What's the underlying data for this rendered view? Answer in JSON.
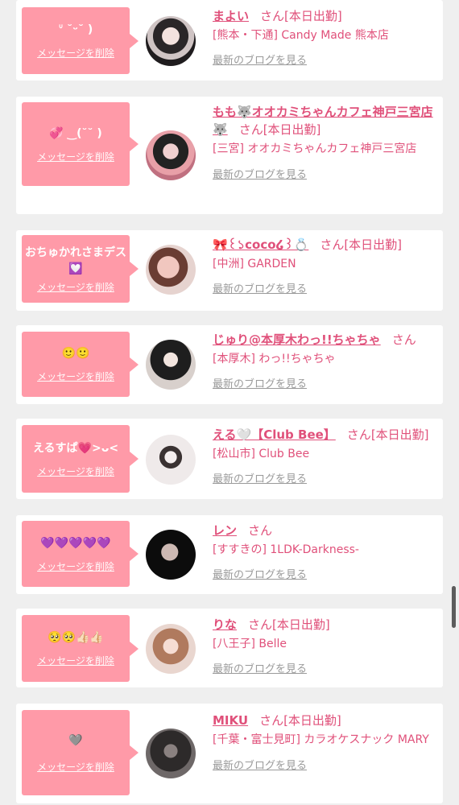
{
  "delete_label": "メッセージを削除",
  "san_suffix": "さん",
  "blog_link": "最新のブログを見る",
  "colors": {
    "accent": "#e0507a",
    "bubble": "#ff9aa8"
  },
  "entries": [
    {
      "message": "ᐡ ˘ᵕ˘ )",
      "name": "まよい",
      "status": "[本日出勤]",
      "shop": "[熊本・下通] Candy Made 熊本店"
    },
    {
      "message": "💞 ‿(˘˘ )",
      "name": "もも🐺オオカミちゃんカフェ神戸三宮店🐺",
      "status": "[本日出勤]",
      "shop": "[三宮] オオカミちゃんカフェ神戸三宮店"
    },
    {
      "message": "おちゅかれさまデス💟",
      "name": "🎀꒰১coco໒꒱💍",
      "status": "[本日出勤]",
      "shop": "[中洲] GARDEN"
    },
    {
      "message": "🙂🙂",
      "name": "じゅり@本厚木わっ!!ちゃちゃ",
      "status": "",
      "shop": "[本厚木] わっ!!ちゃちゃ"
    },
    {
      "message": "えるすぱ💗>ᴗ<",
      "name": "える🤍【Club Bee】",
      "status": "[本日出勤]",
      "shop": "[松山市] Club Bee"
    },
    {
      "message": "💜💜💜💜💜",
      "name": "レン",
      "status": "",
      "shop": "[すすきの] 1LDK-Darkness-"
    },
    {
      "message": "🥺🥺👍🏻👍🏻",
      "name": "りな",
      "status": "[本日出勤]",
      "shop": "[八王子] Belle"
    },
    {
      "message": "🩶",
      "name": "MIKU",
      "status": "[本日出勤]",
      "shop": "[千葉・富士見町] カラオケスナック MARY"
    }
  ]
}
